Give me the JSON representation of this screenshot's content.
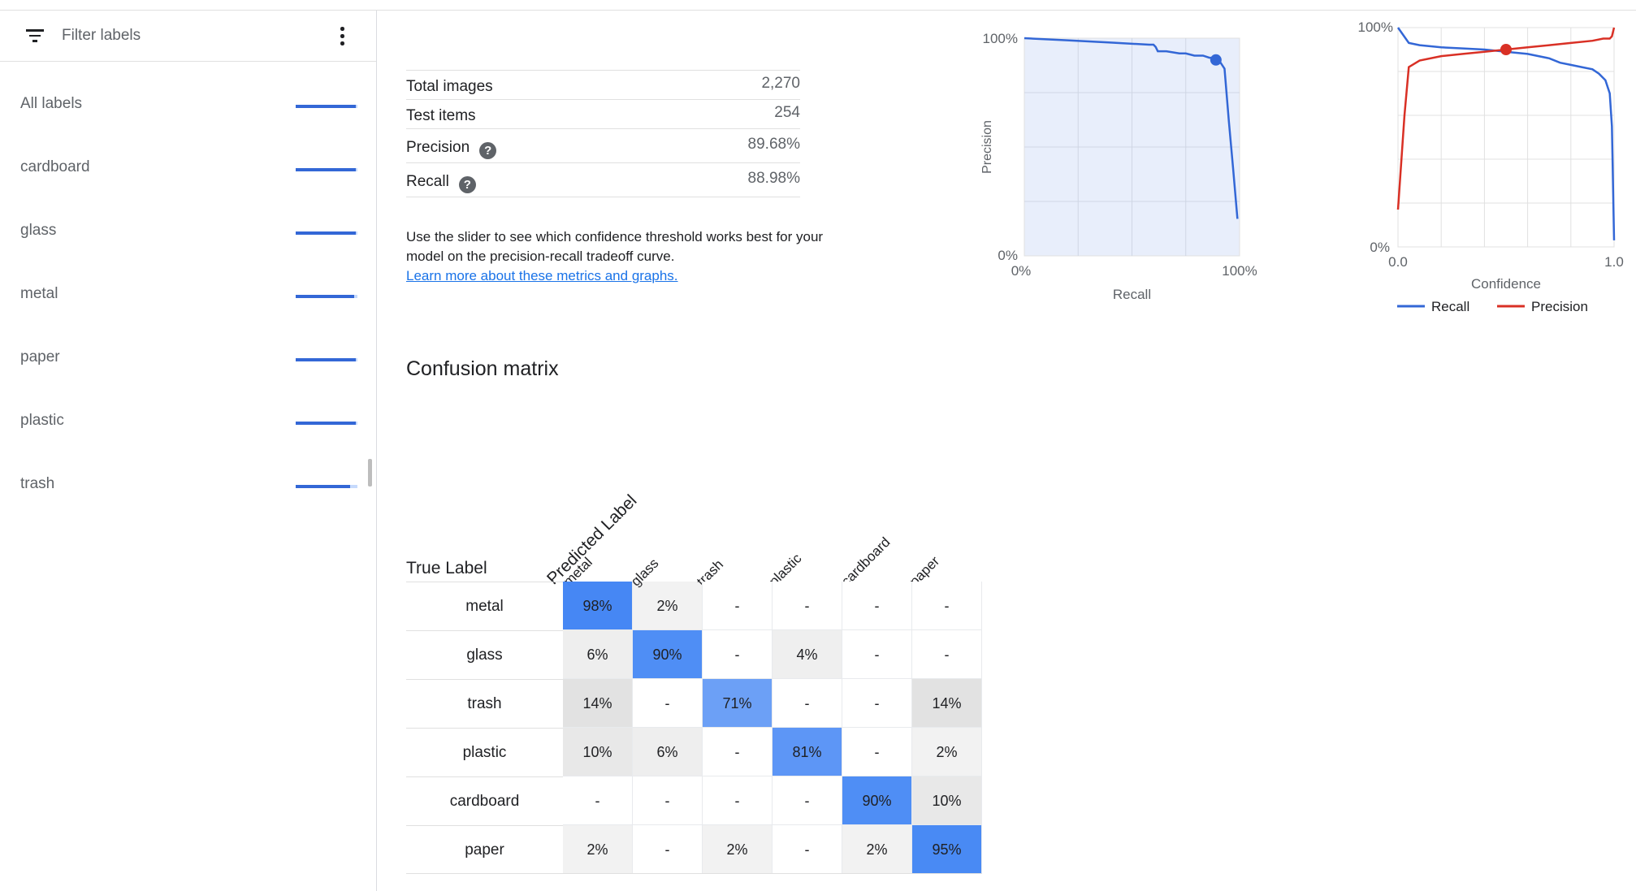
{
  "sidebar": {
    "filter_placeholder": "Filter labels",
    "labels": [
      {
        "name": "All labels",
        "score": 0.97
      },
      {
        "name": "cardboard",
        "score": 0.98
      },
      {
        "name": "glass",
        "score": 0.97
      },
      {
        "name": "metal",
        "score": 0.95
      },
      {
        "name": "paper",
        "score": 0.98
      },
      {
        "name": "plastic",
        "score": 0.97
      },
      {
        "name": "trash",
        "score": 0.88
      }
    ]
  },
  "metrics": [
    {
      "key": "Total images",
      "value": "2,270",
      "help": false
    },
    {
      "key": "Test items",
      "value": "254",
      "help": false
    },
    {
      "key": "Precision",
      "value": "89.68%",
      "help": true
    },
    {
      "key": "Recall",
      "value": "88.98%",
      "help": true
    }
  ],
  "help_glyph": "?",
  "description": {
    "text": "Use the slider to see which confidence threshold works best for your model on the precision-recall tradeoff curve.",
    "link": "Learn more about these metrics and graphs."
  },
  "chart_data": [
    {
      "type": "line",
      "xlabel": "Recall",
      "ylabel": "Precision",
      "x_ticks": [
        "0%",
        "100%"
      ],
      "y_ticks": [
        "0%",
        "100%"
      ],
      "xlim": [
        0,
        1
      ],
      "ylim": [
        0,
        1
      ],
      "grid": true,
      "series": [
        {
          "color": "#3367d6",
          "area": true,
          "x": [
            0.0,
            0.2,
            0.4,
            0.58,
            0.6,
            0.61,
            0.62,
            0.66,
            0.72,
            0.75,
            0.79,
            0.83,
            0.86,
            0.88,
            0.89,
            0.9,
            0.91,
            0.93,
            0.95,
            0.97,
            0.99
          ],
          "y": [
            1.0,
            0.99,
            0.98,
            0.97,
            0.97,
            0.96,
            0.94,
            0.94,
            0.93,
            0.93,
            0.92,
            0.92,
            0.91,
            0.91,
            0.9,
            0.9,
            0.89,
            0.86,
            0.62,
            0.4,
            0.17
          ]
        }
      ],
      "highlight_point": {
        "x": 0.89,
        "y": 0.9
      }
    },
    {
      "type": "line",
      "xlabel": "Confidence",
      "x_ticks": [
        "0.0",
        "1.0"
      ],
      "y_ticks": [
        "0%",
        "100%"
      ],
      "xlim": [
        0,
        1
      ],
      "ylim": [
        0,
        1
      ],
      "grid": true,
      "series": [
        {
          "name": "Recall",
          "color": "#3367d6",
          "x": [
            0.0,
            0.05,
            0.1,
            0.2,
            0.3,
            0.4,
            0.5,
            0.6,
            0.7,
            0.75,
            0.8,
            0.85,
            0.9,
            0.93,
            0.96,
            0.98,
            0.99,
            1.0
          ],
          "y": [
            1.0,
            0.93,
            0.92,
            0.91,
            0.905,
            0.9,
            0.89,
            0.88,
            0.86,
            0.84,
            0.83,
            0.82,
            0.81,
            0.79,
            0.76,
            0.7,
            0.55,
            0.03
          ]
        },
        {
          "name": "Precision",
          "color": "#d93025",
          "x": [
            0.0,
            0.03,
            0.05,
            0.1,
            0.2,
            0.3,
            0.4,
            0.5,
            0.6,
            0.7,
            0.8,
            0.9,
            0.95,
            0.98,
            0.99,
            1.0
          ],
          "y": [
            0.17,
            0.6,
            0.82,
            0.85,
            0.87,
            0.88,
            0.89,
            0.9,
            0.91,
            0.92,
            0.93,
            0.94,
            0.95,
            0.95,
            0.96,
            1.0
          ]
        }
      ],
      "highlight_point": {
        "x": 0.5,
        "y": 0.9
      },
      "legend": "bottom"
    },
    {
      "type": "heatmap",
      "title": "Confusion matrix",
      "row_axis_label": "True Label",
      "col_axis_label": "Predicted Label",
      "rows": [
        "metal",
        "glass",
        "trash",
        "plastic",
        "cardboard",
        "paper"
      ],
      "cols": [
        "metal",
        "glass",
        "trash",
        "plastic",
        "cardboard",
        "paper"
      ],
      "values": [
        [
          98,
          2,
          null,
          null,
          null,
          null
        ],
        [
          6,
          90,
          null,
          4,
          null,
          null
        ],
        [
          14,
          null,
          71,
          null,
          null,
          14
        ],
        [
          10,
          6,
          null,
          81,
          null,
          2
        ],
        [
          null,
          null,
          null,
          null,
          90,
          10
        ],
        [
          2,
          null,
          2,
          null,
          2,
          95
        ]
      ],
      "empty_symbol": "-",
      "diagonal_color": "#4285f4",
      "offdiagonal_color": "#9e9e9e"
    }
  ]
}
